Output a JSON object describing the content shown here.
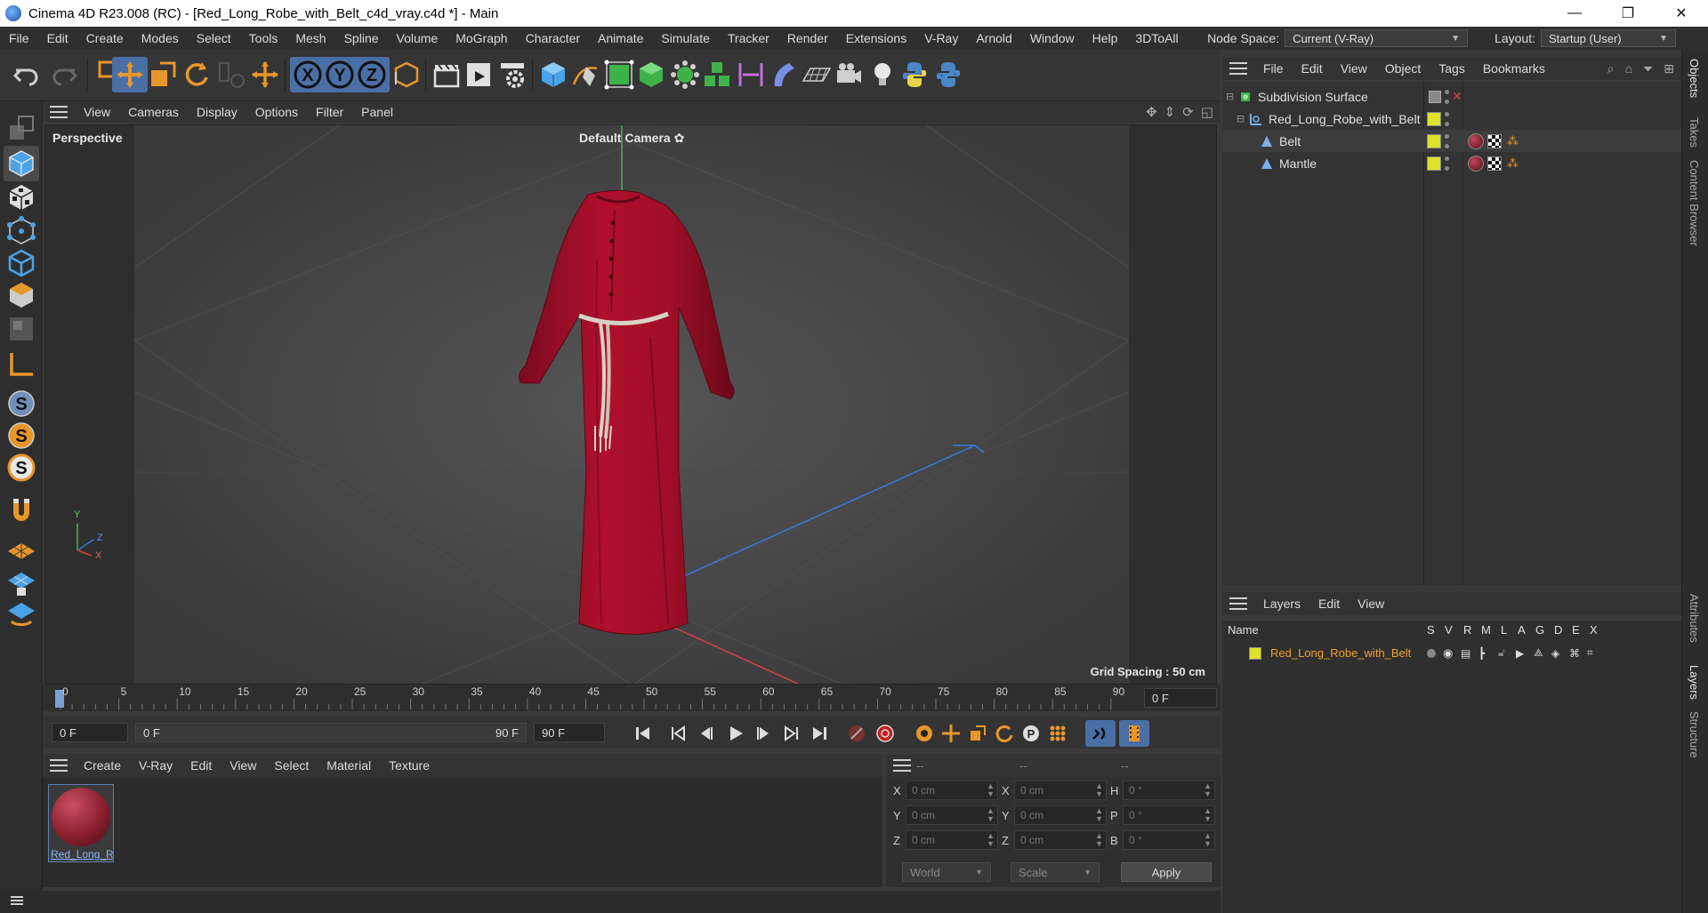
{
  "window": {
    "title": "Cinema 4D R23.008 (RC) - [Red_Long_Robe_with_Belt_c4d_vray.c4d *] - Main",
    "minimize": "—",
    "maximize": "❐",
    "close": "✕"
  },
  "menubar": {
    "items": [
      "File",
      "Edit",
      "Create",
      "Modes",
      "Select",
      "Tools",
      "Mesh",
      "Spline",
      "Volume",
      "MoGraph",
      "Character",
      "Animate",
      "Simulate",
      "Tracker",
      "Render",
      "Extensions",
      "V-Ray",
      "Arnold",
      "Window",
      "Help",
      "3DToAll"
    ],
    "node_space_label": "Node Space:",
    "node_space_value": "Current (V-Ray)",
    "layout_label": "Layout:",
    "layout_value": "Startup (User)"
  },
  "viewport": {
    "menu": [
      "View",
      "Cameras",
      "Display",
      "Options",
      "Filter",
      "Panel"
    ],
    "projection": "Perspective",
    "camera": "Default Camera",
    "camera_suffix": "✿",
    "grid_spacing": "Grid Spacing : 50 cm",
    "axis": {
      "y": "Y",
      "z": "Z",
      "x": "X"
    }
  },
  "timeline": {
    "ticks": [
      "0",
      "5",
      "10",
      "15",
      "20",
      "25",
      "30",
      "35",
      "40",
      "45",
      "50",
      "55",
      "60",
      "65",
      "70",
      "75",
      "80",
      "85",
      "90"
    ],
    "current_frame_field": "0 F",
    "start_field": "0 F",
    "range_start": "0 F",
    "range_end": "90 F",
    "end_field": "90 F"
  },
  "material_manager": {
    "menu": [
      "Create",
      "V-Ray",
      "Edit",
      "View",
      "Select",
      "Material",
      "Texture"
    ],
    "materials": [
      {
        "name": "Red_Long_R"
      }
    ]
  },
  "coordinates": {
    "headers": [
      "--",
      "--",
      "--"
    ],
    "rows": [
      {
        "l1": "X",
        "v1": "0 cm",
        "l2": "X",
        "v2": "0 cm",
        "l3": "H",
        "v3": "0 °"
      },
      {
        "l1": "Y",
        "v1": "0 cm",
        "l2": "Y",
        "v2": "0 cm",
        "l3": "P",
        "v3": "0 °"
      },
      {
        "l1": "Z",
        "v1": "0 cm",
        "l2": "Z",
        "v2": "0 cm",
        "l3": "B",
        "v3": "0 °"
      }
    ],
    "space": "World",
    "mode": "Scale",
    "apply": "Apply"
  },
  "object_manager": {
    "menu": [
      "File",
      "Edit",
      "View",
      "Object",
      "Tags",
      "Bookmarks"
    ],
    "objects": [
      {
        "name": "Subdivision Surface"
      },
      {
        "name": "Red_Long_Robe_with_Belt"
      },
      {
        "name": "Belt"
      },
      {
        "name": "Mantle"
      }
    ]
  },
  "layer_manager": {
    "menu": [
      "Layers",
      "Edit",
      "View"
    ],
    "columns": {
      "name": "Name",
      "flags": [
        "S",
        "V",
        "R",
        "M",
        "L",
        "A",
        "G",
        "D",
        "E",
        "X"
      ]
    },
    "layers": [
      {
        "name": "Red_Long_Robe_with_Belt",
        "color": "#e8e02a"
      }
    ]
  },
  "side_tabs": [
    "Objects",
    "Takes",
    "Content Browser",
    "Attributes",
    "Layers",
    "Structure"
  ],
  "colors": {
    "accent": "#4a6fa5",
    "robe": "#b0102c",
    "layer_name": "#f0a030"
  }
}
